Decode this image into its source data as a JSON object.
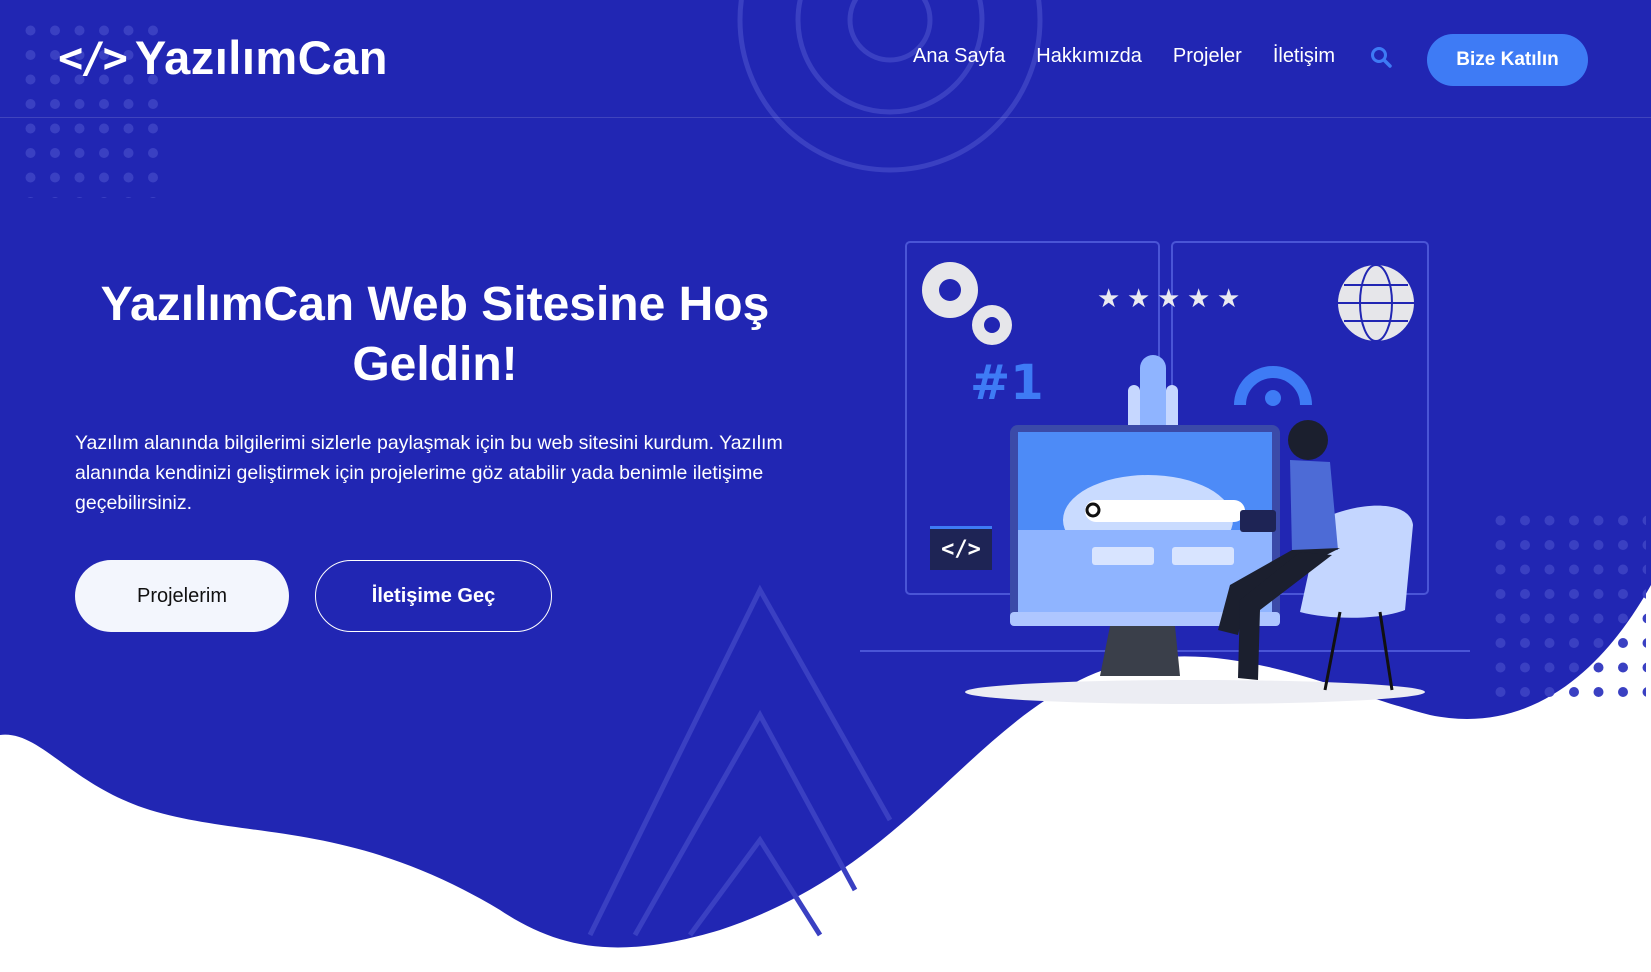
{
  "colors": {
    "primary_bg": "#2126b3",
    "accent": "#3e7bf5",
    "white": "#ffffff"
  },
  "header": {
    "logo_icon": "</>",
    "logo_text": "YazılımCan",
    "nav": [
      {
        "label": "Ana Sayfa"
      },
      {
        "label": "Hakkımızda"
      },
      {
        "label": "Projeler"
      },
      {
        "label": "İletişim"
      }
    ],
    "search_icon": "search-icon",
    "join_label": "Bize Katılın"
  },
  "hero": {
    "title": "YazılımCan Web Sitesine Hoş Geldin!",
    "description": "Yazılım alanında bilgilerimi sizlerle paylaşmak için bu web sitesini kurdum. Yazılım alanında kendinizi geliştirmek için projelerime göz atabilir yada benimle iletişime geçebilirsiniz.",
    "primary_button": "Projelerim",
    "secondary_button": "İletişime Geç"
  },
  "illustration": {
    "rank_label": "#1",
    "code_label": "</>",
    "stars": 5
  }
}
